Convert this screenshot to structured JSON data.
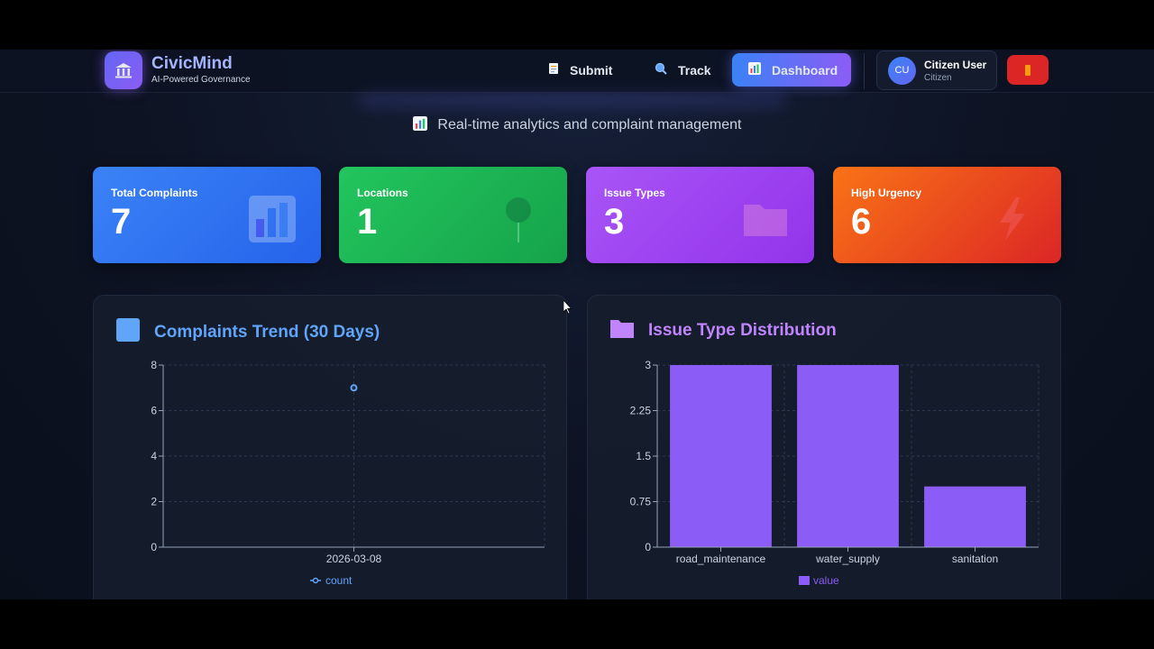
{
  "app": {
    "name": "CivicMind",
    "tagline": "AI-Powered Governance"
  },
  "nav": {
    "submit": {
      "label": "Submit",
      "icon": "document-icon"
    },
    "track": {
      "label": "Track",
      "icon": "search-icon"
    },
    "dashboard": {
      "label": "Dashboard",
      "icon": "chart-icon"
    }
  },
  "user": {
    "initials": "CU",
    "name": "Citizen User",
    "role": "Citizen"
  },
  "page": {
    "subtitle": "Real-time analytics and complaint management"
  },
  "stats": [
    {
      "label": "Total Complaints",
      "value": "7",
      "color": "#3b82f6",
      "icon": "bar-chart-icon"
    },
    {
      "label": "Locations",
      "value": "1",
      "color": "#22c55e",
      "icon": "pin-icon"
    },
    {
      "label": "Issue Types",
      "value": "3",
      "color": "#a855f7",
      "icon": "folder-icon"
    },
    {
      "label": "High Urgency",
      "value": "6",
      "color": "#f97316",
      "icon": "lightning-icon"
    }
  ],
  "charts": {
    "trend_title": "Complaints Trend (30 Days)",
    "dist_title": "Issue Type Distribution"
  },
  "chart_data": [
    {
      "type": "line",
      "title": "Complaints Trend (30 Days)",
      "x": [
        "2026-03-08"
      ],
      "series": [
        {
          "name": "count",
          "values": [
            7
          ],
          "color": "#60a5fa"
        }
      ],
      "ylim": [
        0,
        8
      ],
      "yticks": [
        0,
        2,
        4,
        6,
        8
      ],
      "grid": true,
      "legend": "bottom"
    },
    {
      "type": "bar",
      "title": "Issue Type Distribution",
      "categories": [
        "road_maintenance",
        "water_supply",
        "sanitation"
      ],
      "series": [
        {
          "name": "value",
          "values": [
            3,
            3,
            1
          ],
          "color": "#8b5cf6"
        }
      ],
      "ylim": [
        0,
        3
      ],
      "yticks": [
        0,
        0.75,
        1.5,
        2.25,
        3
      ],
      "grid": true,
      "legend": "bottom"
    }
  ]
}
